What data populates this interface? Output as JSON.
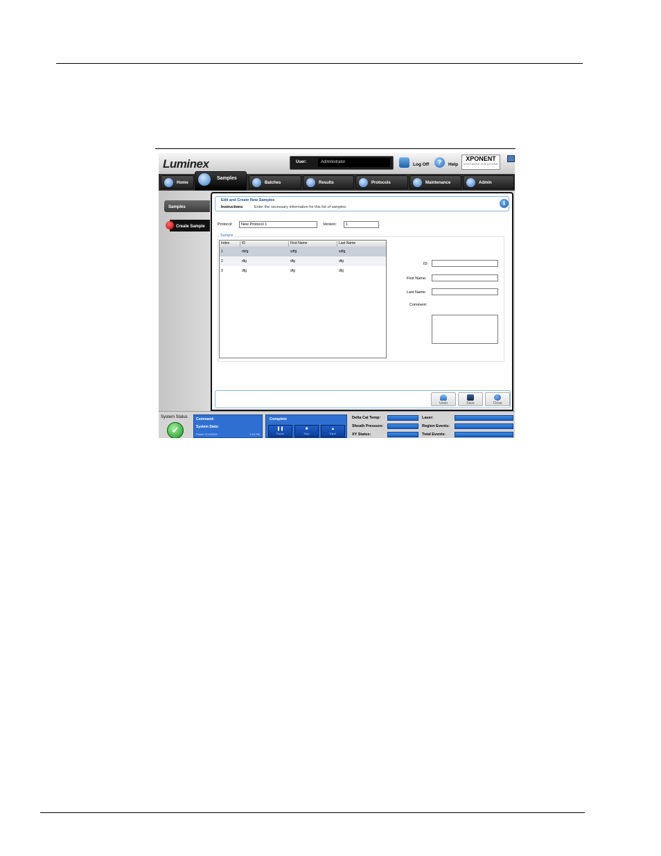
{
  "app": {
    "logo": "Luminex",
    "user_label": "User:",
    "user_value": "Administrator",
    "logoff_label": "Log Off",
    "help_label": "Help",
    "brand_main": "XPONENT",
    "brand_sub": "SOFTWARE SOLUTIONS"
  },
  "tabs": [
    {
      "label": "Home",
      "icon": "home-icon"
    },
    {
      "label": "Samples",
      "icon": "samples-icon",
      "active": true
    },
    {
      "label": "Batches",
      "icon": "batches-icon"
    },
    {
      "label": "Results",
      "icon": "results-icon"
    },
    {
      "label": "Protocols",
      "icon": "protocols-icon"
    },
    {
      "label": "Maintenance",
      "icon": "maintenance-icon"
    },
    {
      "label": "Admin",
      "icon": "admin-icon"
    }
  ],
  "sidebar": {
    "samples": "Samples",
    "create_sample": "Create Sample"
  },
  "panel": {
    "title": "Edit and Create New Samples",
    "instructions_label": "Instructions",
    "instructions_text": "Enter the necessary information for this list of samples.",
    "protocol_label": "Protocol:",
    "protocol_value": "New Protocol 1",
    "version_label": "Version:",
    "version_value": "1",
    "group_label": "Sample",
    "columns": [
      "Index",
      "ID",
      "First Name",
      "Last Name"
    ],
    "rows": [
      [
        "1",
        "dsfg",
        "sdfg",
        "sdfg"
      ],
      [
        "2",
        "dfg",
        "dfg",
        "dfg"
      ],
      [
        "3",
        "dfg",
        "dfg",
        "dfg"
      ]
    ],
    "id_label": "ID:",
    "first_name_label": "First Name:",
    "last_name_label": "Last Name:",
    "comment_label": "Comment:"
  },
  "toolbar": {
    "undo": "Undo",
    "save": "Save",
    "close": "Close"
  },
  "status": {
    "system_status": "System Status",
    "command_label": "Command:",
    "system_state_label": "System State:",
    "printer_label": "Printer 3/14/2009",
    "time": "2:18 PM",
    "run_state": "Complete",
    "pause": "Pause",
    "stop": "Stop",
    "eject": "Eject",
    "delta_cal_temp": "Delta Cal Temp:",
    "sheath_pressure": "Sheath Pressure:",
    "xy_status": "XY Status:",
    "laser": "Laser:",
    "region_events": "Region Events:",
    "total_events": "Total Events:"
  }
}
